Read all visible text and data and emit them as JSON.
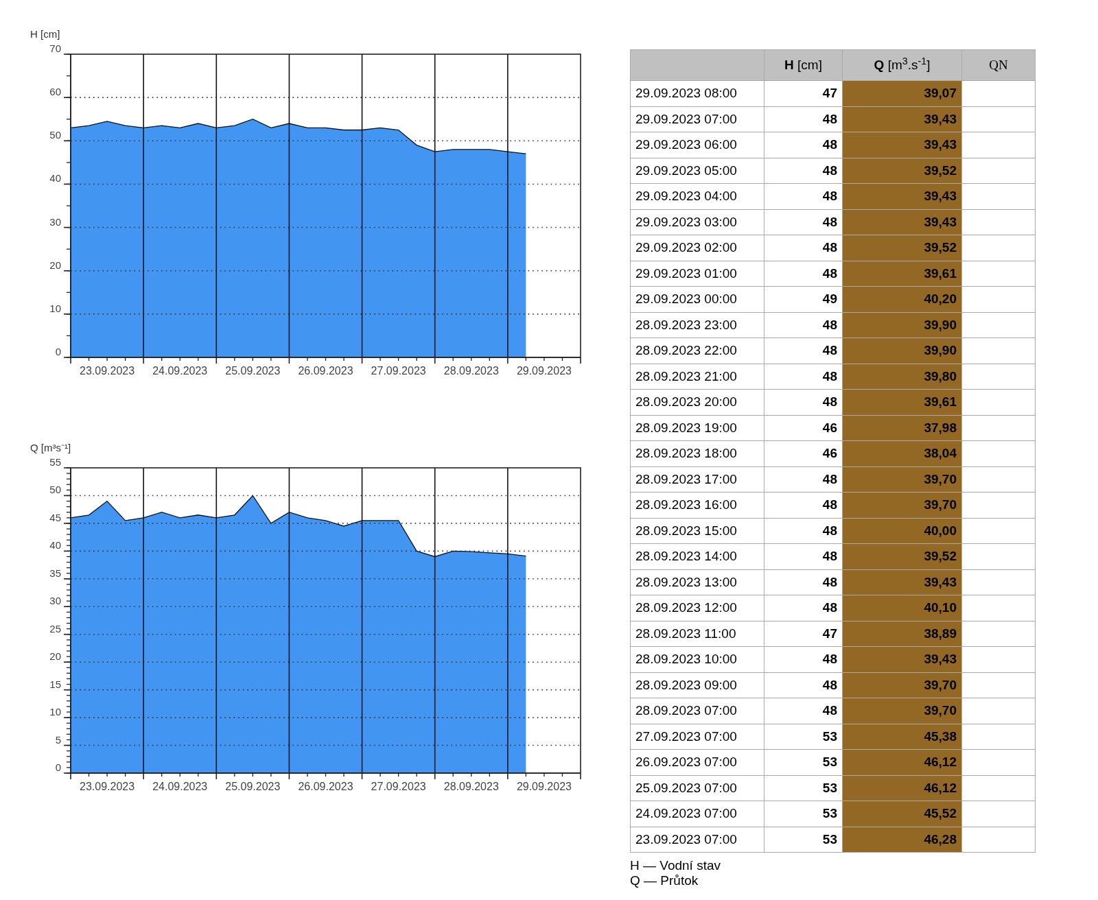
{
  "charts": [
    {
      "chart_data": {
        "type": "area",
        "ylabel": "H [cm]",
        "categories": [
          null,
          null,
          "23.09.2023",
          null,
          null,
          null,
          "24.09.2023",
          null,
          null,
          null,
          "25.09.2023",
          null,
          null,
          null,
          "26.09.2023",
          null,
          null,
          null,
          "27.09.2023",
          null,
          null,
          null,
          "28.09.2023",
          null,
          null,
          null,
          "29.09.2023",
          null
        ],
        "series": [
          {
            "color": "#4296f2",
            "values": [
              53,
              53.5,
              54.5,
              53.5,
              53,
              53.5,
              53,
              54,
              53,
              53.5,
              55,
              53,
              54,
              53,
              53,
              52.5,
              52.5,
              53,
              52.5,
              49,
              47.5,
              48,
              48,
              48,
              47.5,
              47,
              null,
              null
            ]
          }
        ],
        "ylim": [
          0,
          70
        ],
        "grid": true,
        "yticks": [
          0,
          10,
          20,
          30,
          40,
          50,
          60,
          70
        ]
      }
    },
    {
      "chart_data": {
        "type": "area",
        "ylabel": "Q [m³s⁻¹]",
        "categories": [
          null,
          null,
          "23.09.2023",
          null,
          null,
          null,
          "24.09.2023",
          null,
          null,
          null,
          "25.09.2023",
          null,
          null,
          null,
          "26.09.2023",
          null,
          null,
          null,
          "27.09.2023",
          null,
          null,
          null,
          "28.09.2023",
          null,
          null,
          null,
          "29.09.2023",
          null
        ],
        "series": [
          {
            "color": "#4296f2",
            "values": [
              46,
              46.5,
              49,
              45.5,
              46,
              47,
              46,
              46.5,
              46,
              46.5,
              50,
              45,
              47,
              46,
              45.5,
              44.5,
              45.5,
              45.5,
              45.5,
              40,
              39,
              40,
              39.9,
              39.7,
              39.5,
              39.1,
              null,
              null
            ]
          }
        ],
        "ylim": [
          0,
          55
        ],
        "grid": true,
        "yticks": [
          0,
          5,
          10,
          15,
          20,
          25,
          30,
          35,
          40,
          45,
          50,
          55
        ]
      }
    }
  ],
  "table": {
    "columns": [
      {
        "label": "**H** [cm]"
      },
      {
        "label": "**Q** [m$^{3}$.s$^{-1}$]"
      },
      {
        "label": "QN"
      }
    ],
    "rows": [
      {
        "time": "29.09.2023 08:00",
        "h": "47",
        "q": "39,07"
      },
      {
        "time": "29.09.2023 07:00",
        "h": "48",
        "q": "39,43"
      },
      {
        "time": "29.09.2023 06:00",
        "h": "48",
        "q": "39,43"
      },
      {
        "time": "29.09.2023 05:00",
        "h": "48",
        "q": "39,52"
      },
      {
        "time": "29.09.2023 04:00",
        "h": "48",
        "q": "39,43"
      },
      {
        "time": "29.09.2023 03:00",
        "h": "48",
        "q": "39,43"
      },
      {
        "time": "29.09.2023 02:00",
        "h": "48",
        "q": "39,52"
      },
      {
        "time": "29.09.2023 01:00",
        "h": "48",
        "q": "39,61"
      },
      {
        "time": "29.09.2023 00:00",
        "h": "49",
        "q": "40,20"
      },
      {
        "time": "28.09.2023 23:00",
        "h": "48",
        "q": "39,90"
      },
      {
        "time": "28.09.2023 22:00",
        "h": "48",
        "q": "39,90"
      },
      {
        "time": "28.09.2023 21:00",
        "h": "48",
        "q": "39,80"
      },
      {
        "time": "28.09.2023 20:00",
        "h": "48",
        "q": "39,61"
      },
      {
        "time": "28.09.2023 19:00",
        "h": "46",
        "q": "37,98"
      },
      {
        "time": "28.09.2023 18:00",
        "h": "46",
        "q": "38,04"
      },
      {
        "time": "28.09.2023 17:00",
        "h": "48",
        "q": "39,70"
      },
      {
        "time": "28.09.2023 16:00",
        "h": "48",
        "q": "39,70"
      },
      {
        "time": "28.09.2023 15:00",
        "h": "48",
        "q": "40,00"
      },
      {
        "time": "28.09.2023 14:00",
        "h": "48",
        "q": "39,52"
      },
      {
        "time": "28.09.2023 13:00",
        "h": "48",
        "q": "39,43"
      },
      {
        "time": "28.09.2023 12:00",
        "h": "48",
        "q": "40,10"
      },
      {
        "time": "28.09.2023 11:00",
        "h": "47",
        "q": "38,89"
      },
      {
        "time": "28.09.2023 10:00",
        "h": "48",
        "q": "39,43"
      },
      {
        "time": "28.09.2023 09:00",
        "h": "48",
        "q": "39,70"
      },
      {
        "time": "28.09.2023 07:00",
        "h": "48",
        "q": "39,70"
      },
      {
        "time": "27.09.2023 07:00",
        "h": "53",
        "q": "45,38"
      },
      {
        "time": "26.09.2023 07:00",
        "h": "53",
        "q": "46,12"
      },
      {
        "time": "25.09.2023 07:00",
        "h": "53",
        "q": "46,12"
      },
      {
        "time": "24.09.2023 07:00",
        "h": "53",
        "q": "45,52"
      },
      {
        "time": "23.09.2023 07:00",
        "h": "53",
        "q": "46,28"
      }
    ]
  },
  "legend": [
    "H — Vodní stav",
    "Q — Průtok"
  ]
}
